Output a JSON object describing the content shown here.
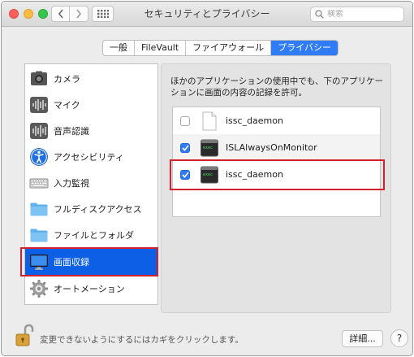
{
  "window": {
    "title": "セキュリティとプライバシー",
    "search_placeholder": "検索"
  },
  "tabs": [
    {
      "label": "一般",
      "active": false
    },
    {
      "label": "FileVault",
      "active": false
    },
    {
      "label": "ファイアウォール",
      "active": false
    },
    {
      "label": "プライバシー",
      "active": true
    }
  ],
  "sidebar": {
    "items": [
      {
        "label": "カメラ",
        "icon": "camera-icon"
      },
      {
        "label": "マイク",
        "icon": "microphone-icon"
      },
      {
        "label": "音声認識",
        "icon": "speech-recognition-icon"
      },
      {
        "label": "アクセシビリティ",
        "icon": "accessibility-icon"
      },
      {
        "label": "入力監視",
        "icon": "keyboard-icon"
      },
      {
        "label": "フルディスクアクセス",
        "icon": "folder-icon"
      },
      {
        "label": "ファイルとフォルダ",
        "icon": "folder-icon"
      },
      {
        "label": "画面収録",
        "icon": "display-icon",
        "selected": true
      },
      {
        "label": "オートメーション",
        "icon": "gear-icon"
      }
    ]
  },
  "panel": {
    "description": "ほかのアプリケーションの使用中でも、下のアプリケーションに画面の内容の記録を許可。",
    "apps": [
      {
        "name": "issc_daemon",
        "checked": false,
        "icon": "document-icon"
      },
      {
        "name": "ISLAlwaysOnMonitor",
        "checked": true,
        "icon": "terminal-icon"
      },
      {
        "name": "issc_daemon",
        "checked": true,
        "icon": "terminal-icon"
      }
    ]
  },
  "footer": {
    "lock_text": "変更できないようにするにはカギをクリックします。",
    "details_label": "詳細...",
    "help_label": "?"
  },
  "colors": {
    "accent": "#2f7cf6",
    "selection": "#0d5fe6",
    "highlight_box": "#d2202c"
  }
}
